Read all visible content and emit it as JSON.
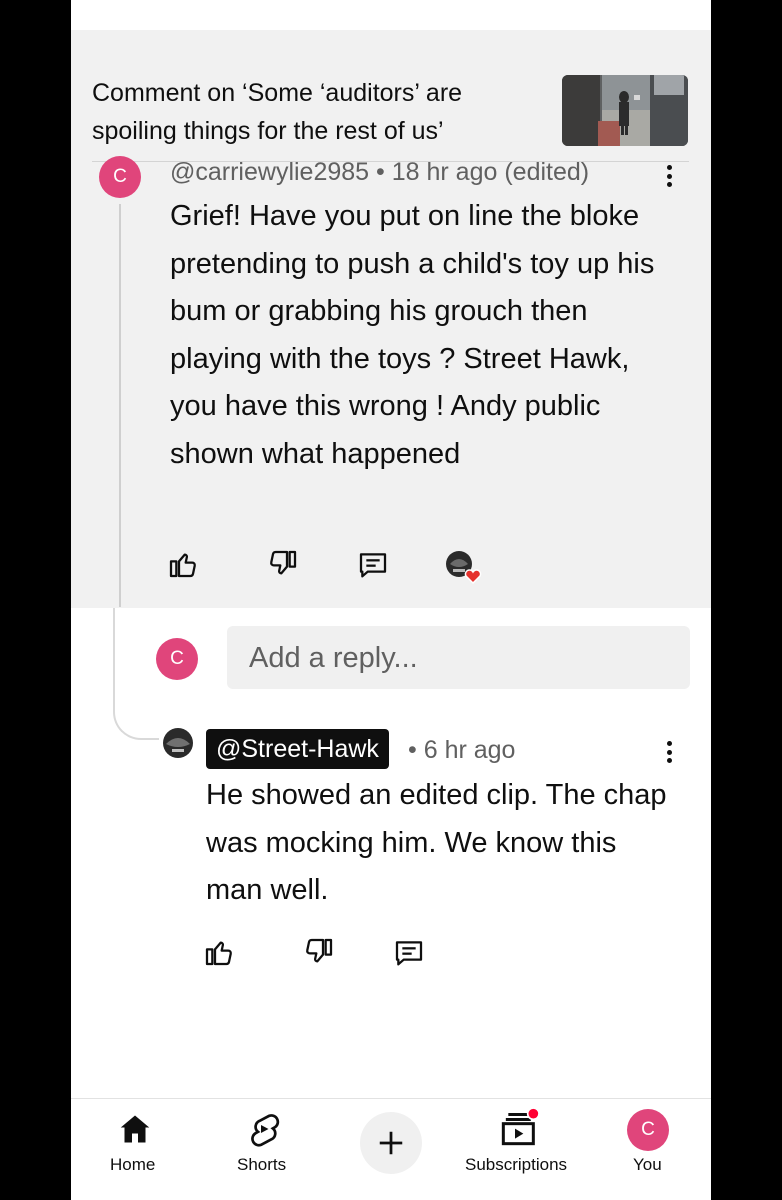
{
  "context": {
    "title": "Comment on ‘Some ‘auditors’ are spoiling things for the rest of us’"
  },
  "parent_comment": {
    "avatar_initial": "C",
    "handle": "@carriewylie2985",
    "time": "18 hr ago (edited)",
    "body": "Grief! Have you put on line the bloke pretending to push a child's toy up his bum or grabbing his grouch then playing with the toys ? Street Hawk, you have this wrong ! Andy public shown what happened"
  },
  "reply_box": {
    "avatar_initial": "C",
    "placeholder": "Add a reply..."
  },
  "reply_comment": {
    "handle": "@Street-Hawk",
    "time": "6 hr ago",
    "body": "He showed an edited clip. The chap was mocking him. We know this man well."
  },
  "nav": {
    "home": "Home",
    "shorts": "Shorts",
    "subscriptions": "Subscriptions",
    "you": "You",
    "you_initial": "C"
  },
  "colors": {
    "avatar": "#e0457b",
    "notification": "#ff0033",
    "heart": "#e5322d"
  }
}
